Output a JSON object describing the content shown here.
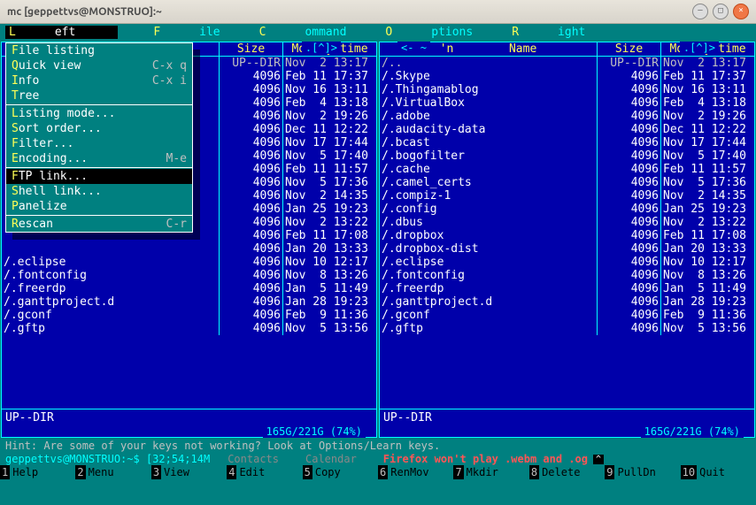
{
  "window_title": "mc [geppettvs@MONSTRUO]:~",
  "menubar": {
    "left": "Left",
    "file": "File",
    "command": "Command",
    "options": "Options",
    "right": "Right"
  },
  "dropdown": {
    "items": [
      {
        "hot": "F",
        "rest": "ile listing",
        "shortcut": ""
      },
      {
        "hot": "Q",
        "rest": "uick view",
        "shortcut": "C-x q"
      },
      {
        "hot": "I",
        "rest": "nfo",
        "shortcut": "C-x i"
      },
      {
        "hot": "T",
        "rest": "ree",
        "shortcut": ""
      }
    ],
    "items2": [
      {
        "hot": "L",
        "rest": "isting mode...",
        "shortcut": ""
      },
      {
        "hot": "S",
        "rest": "ort order...",
        "shortcut": ""
      },
      {
        "hot": "F",
        "rest": "ilter...",
        "shortcut": ""
      },
      {
        "hot": "E",
        "rest": "ncoding...",
        "shortcut": "M-e"
      }
    ],
    "items3": [
      {
        "hot": "F",
        "rest": "TP link...",
        "shortcut": "",
        "selected": true
      },
      {
        "hot": "S",
        "rest": "hell link...",
        "shortcut": ""
      },
      {
        "hot": "P",
        "rest": "anelize",
        "shortcut": ""
      }
    ],
    "items4": [
      {
        "hot": "R",
        "rest": "escan",
        "shortcut": "C-r"
      }
    ]
  },
  "panel_header": ".[^]>",
  "right_header_prefix": "<-",
  "right_header_center": "~",
  "cols": {
    "name": "Name",
    "name_right_prefix": "'n",
    "size": "Size",
    "modify": "Modify time"
  },
  "left_rows": [
    {
      "name": "",
      "size": "UP--DIR",
      "mod": "Nov  2 13:17",
      "white": false
    },
    {
      "name": "",
      "size": "4096",
      "mod": "Feb 11 17:37",
      "white": true
    },
    {
      "name": "",
      "size": "4096",
      "mod": "Nov 16 13:11",
      "white": true
    },
    {
      "name": "",
      "size": "4096",
      "mod": "Feb  4 13:18",
      "white": true
    },
    {
      "name": "",
      "size": "4096",
      "mod": "Nov  2 19:26",
      "white": true
    },
    {
      "name": "",
      "size": "4096",
      "mod": "Dec 11 12:22",
      "white": true
    },
    {
      "name": "",
      "size": "4096",
      "mod": "Nov 17 17:44",
      "white": true
    },
    {
      "name": "",
      "size": "4096",
      "mod": "Nov  5 17:40",
      "white": true
    },
    {
      "name": "",
      "size": "4096",
      "mod": "Feb 11 11:57",
      "white": true
    },
    {
      "name": "",
      "size": "4096",
      "mod": "Nov  5 17:36",
      "white": true
    },
    {
      "name": "",
      "size": "4096",
      "mod": "Nov  2 14:35",
      "white": true
    },
    {
      "name": "",
      "size": "4096",
      "mod": "Jan 25 19:23",
      "white": true
    },
    {
      "name": "",
      "size": "4096",
      "mod": "Nov  2 13:22",
      "white": true
    },
    {
      "name": "",
      "size": "4096",
      "mod": "Feb 11 17:08",
      "white": true
    },
    {
      "name": "",
      "size": "4096",
      "mod": "Jan 20 13:33",
      "white": true
    },
    {
      "name": "/.eclipse",
      "size": "4096",
      "mod": "Nov 10 12:17",
      "white": true
    },
    {
      "name": "/.fontconfig",
      "size": "4096",
      "mod": "Nov  8 13:26",
      "white": true
    },
    {
      "name": "/.freerdp",
      "size": "4096",
      "mod": "Jan  5 11:49",
      "white": true
    },
    {
      "name": "/.ganttproject.d",
      "size": "4096",
      "mod": "Jan 28 19:23",
      "white": true
    },
    {
      "name": "/.gconf",
      "size": "4096",
      "mod": "Feb  9 11:36",
      "white": true
    },
    {
      "name": "/.gftp",
      "size": "4096",
      "mod": "Nov  5 13:56",
      "white": true
    }
  ],
  "right_rows": [
    {
      "name": "/..",
      "size": "UP--DIR",
      "mod": "Nov  2 13:17",
      "white": false
    },
    {
      "name": "/.Skype",
      "size": "4096",
      "mod": "Feb 11 17:37",
      "white": true
    },
    {
      "name": "/.Thingamablog",
      "size": "4096",
      "mod": "Nov 16 13:11",
      "white": true
    },
    {
      "name": "/.VirtualBox",
      "size": "4096",
      "mod": "Feb  4 13:18",
      "white": true
    },
    {
      "name": "/.adobe",
      "size": "4096",
      "mod": "Nov  2 19:26",
      "white": true
    },
    {
      "name": "/.audacity-data",
      "size": "4096",
      "mod": "Dec 11 12:22",
      "white": true
    },
    {
      "name": "/.bcast",
      "size": "4096",
      "mod": "Nov 17 17:44",
      "white": true
    },
    {
      "name": "/.bogofilter",
      "size": "4096",
      "mod": "Nov  5 17:40",
      "white": true
    },
    {
      "name": "/.cache",
      "size": "4096",
      "mod": "Feb 11 11:57",
      "white": true
    },
    {
      "name": "/.camel_certs",
      "size": "4096",
      "mod": "Nov  5 17:36",
      "white": true
    },
    {
      "name": "/.compiz-1",
      "size": "4096",
      "mod": "Nov  2 14:35",
      "white": true
    },
    {
      "name": "/.config",
      "size": "4096",
      "mod": "Jan 25 19:23",
      "white": true
    },
    {
      "name": "/.dbus",
      "size": "4096",
      "mod": "Nov  2 13:22",
      "white": true
    },
    {
      "name": "/.dropbox",
      "size": "4096",
      "mod": "Feb 11 17:08",
      "white": true
    },
    {
      "name": "/.dropbox-dist",
      "size": "4096",
      "mod": "Jan 20 13:33",
      "white": true
    },
    {
      "name": "/.eclipse",
      "size": "4096",
      "mod": "Nov 10 12:17",
      "white": true
    },
    {
      "name": "/.fontconfig",
      "size": "4096",
      "mod": "Nov  8 13:26",
      "white": true
    },
    {
      "name": "/.freerdp",
      "size": "4096",
      "mod": "Jan  5 11:49",
      "white": true
    },
    {
      "name": "/.ganttproject.d",
      "size": "4096",
      "mod": "Jan 28 19:23",
      "white": true
    },
    {
      "name": "/.gconf",
      "size": "4096",
      "mod": "Feb  9 11:36",
      "white": true
    },
    {
      "name": "/.gftp",
      "size": "4096",
      "mod": "Nov  5 13:56",
      "white": true
    }
  ],
  "footer_text": "UP--DIR",
  "disk_status": "165G/221G (74%)",
  "hint": "Hint: Are some of your keys not working? Look at Options/Learn keys.",
  "prompt_user": "geppettvs@MONSTRUO:~$",
  "prompt_esc": "[32;54;14M",
  "prompt_ghost1": "Contacts",
  "prompt_ghost2": "Calendar",
  "prompt_red": "Firefox won't play .webm and .og",
  "fkeys": [
    {
      "n": "1",
      "t": "Help"
    },
    {
      "n": "2",
      "t": "Menu"
    },
    {
      "n": "3",
      "t": "View"
    },
    {
      "n": "4",
      "t": "Edit"
    },
    {
      "n": "5",
      "t": "Copy"
    },
    {
      "n": "6",
      "t": "RenMov"
    },
    {
      "n": "7",
      "t": "Mkdir"
    },
    {
      "n": "8",
      "t": "Delete"
    },
    {
      "n": "9",
      "t": "PullDn"
    },
    {
      "n": "10",
      "t": "Quit"
    }
  ]
}
